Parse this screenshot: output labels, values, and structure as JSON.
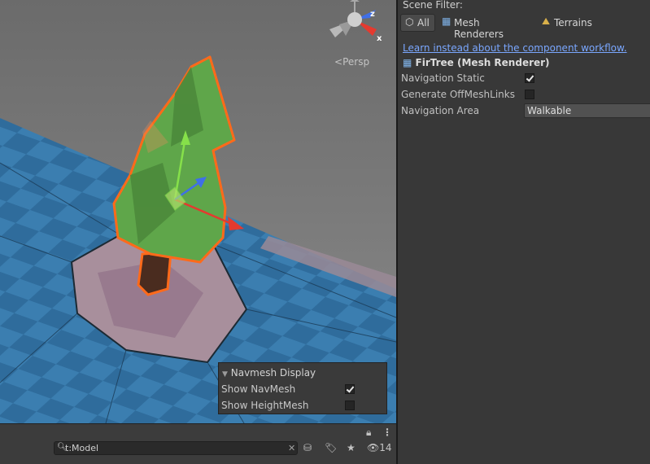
{
  "scene_view": {
    "camera_label": "Persp",
    "gizmo_axes": {
      "z": "z",
      "x": "x"
    },
    "navmesh_overlay": {
      "title": "Navmesh Display",
      "show_navmesh": {
        "label": "Show NavMesh",
        "checked": true
      },
      "show_heightmesh": {
        "label": "Show HeightMesh",
        "checked": false
      }
    }
  },
  "bottom_panel": {
    "search_value": "t:Model",
    "hidden_count": "14"
  },
  "inspector": {
    "scene_filter_label": "Scene Filter:",
    "filters": [
      {
        "label": "All",
        "icon": "cube-icon",
        "active": true
      },
      {
        "label": "Mesh Renderers",
        "icon": "mesh-grid-icon",
        "active": false
      },
      {
        "label": "Terrains",
        "icon": "terrain-icon",
        "active": false
      }
    ],
    "link": "Learn instead about the component workflow.",
    "object_heading": "FirTree (Mesh Renderer)",
    "properties": {
      "navigation_static": {
        "label": "Navigation Static",
        "checked": true
      },
      "offmesh": {
        "label": "Generate OffMeshLinks",
        "checked": false
      },
      "area": {
        "label": "Navigation Area",
        "value": "Walkable"
      }
    }
  },
  "colors": {
    "selection_outline": "#ff6a1a",
    "tree_green": "#5fa64a",
    "link_blue": "#7aa7ff",
    "gizmo_y": "#86e04a",
    "gizmo_x": "#e43a2f",
    "gizmo_z": "#3f6fe8"
  }
}
